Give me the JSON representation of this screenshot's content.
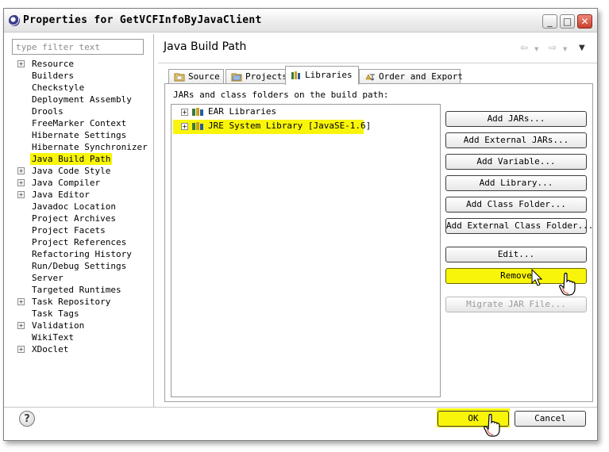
{
  "window": {
    "title": "Properties for GetVCFInfoByJavaClient",
    "controls": {
      "minimize": "_",
      "maximize": "□",
      "close": "✕"
    }
  },
  "filter": {
    "placeholder": "type filter text"
  },
  "tree": [
    {
      "label": "Resource",
      "expandable": true
    },
    {
      "label": "Builders",
      "expandable": false
    },
    {
      "label": "Checkstyle",
      "expandable": false
    },
    {
      "label": "Deployment Assembly",
      "expandable": false
    },
    {
      "label": "Drools",
      "expandable": false
    },
    {
      "label": "FreeMarker Context",
      "expandable": false
    },
    {
      "label": "Hibernate Settings",
      "expandable": false
    },
    {
      "label": "Hibernate Synchronizer",
      "expandable": false
    },
    {
      "label": "Java Build Path",
      "expandable": false,
      "selected": true
    },
    {
      "label": "Java Code Style",
      "expandable": true
    },
    {
      "label": "Java Compiler",
      "expandable": true
    },
    {
      "label": "Java Editor",
      "expandable": true
    },
    {
      "label": "Javadoc Location",
      "expandable": false
    },
    {
      "label": "Project Archives",
      "expandable": false
    },
    {
      "label": "Project Facets",
      "expandable": false
    },
    {
      "label": "Project References",
      "expandable": false
    },
    {
      "label": "Refactoring History",
      "expandable": false
    },
    {
      "label": "Run/Debug Settings",
      "expandable": false
    },
    {
      "label": "Server",
      "expandable": false
    },
    {
      "label": "Targeted Runtimes",
      "expandable": false
    },
    {
      "label": "Task Repository",
      "expandable": true
    },
    {
      "label": "Task Tags",
      "expandable": false
    },
    {
      "label": "Validation",
      "expandable": true
    },
    {
      "label": "WikiText",
      "expandable": false
    },
    {
      "label": "XDoclet",
      "expandable": true
    }
  ],
  "page": {
    "title": "Java Build Path",
    "tabs": {
      "source": "Source",
      "projects": "Projects",
      "libraries": "Libraries",
      "order": "Order and Export"
    },
    "panel_label": "JARs and class folders on the build path:",
    "jars": [
      {
        "label": "EAR Libraries"
      },
      {
        "label": "JRE System Library [JavaSE-1.6]"
      }
    ],
    "buttons": {
      "add_jars": "Add JARs...",
      "add_external_jars": "Add External JARs...",
      "add_variable": "Add Variable...",
      "add_library": "Add Library...",
      "add_class_folder": "Add Class Folder...",
      "add_external_class_folder": "Add External Class Folder...",
      "edit": "Edit...",
      "remove": "Remove",
      "migrate_jar": "Migrate JAR File..."
    }
  },
  "dialog": {
    "help": "?",
    "ok": "OK",
    "cancel": "Cancel"
  },
  "colors": {
    "highlight": "#f9f50a"
  }
}
